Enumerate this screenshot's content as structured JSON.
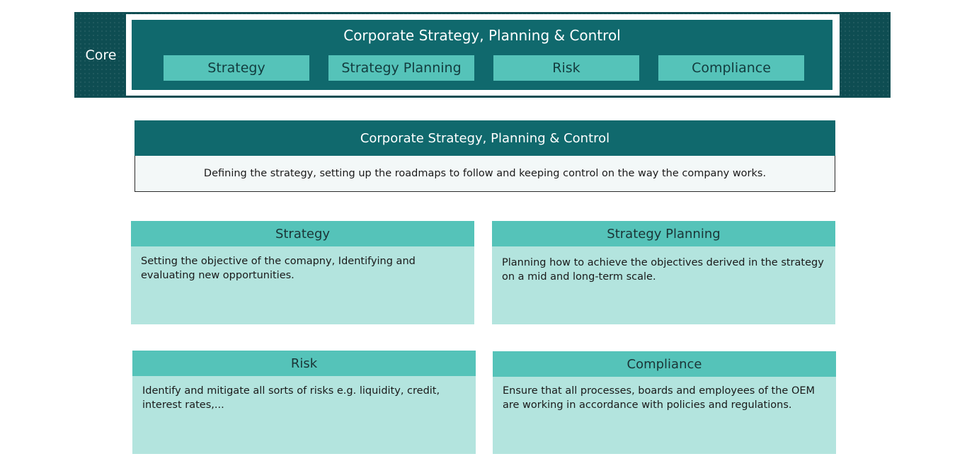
{
  "core": {
    "label": "Core",
    "title": "Corporate Strategy, Planning & Control",
    "tabs": [
      {
        "label": "Strategy"
      },
      {
        "label": "Strategy Planning"
      },
      {
        "label": "Risk"
      },
      {
        "label": "Compliance"
      }
    ]
  },
  "overview": {
    "title": "Corporate Strategy, Planning & Control",
    "description": "Defining the strategy, setting up the roadmaps to follow and keeping control on the way the company works."
  },
  "cards": [
    {
      "title": "Strategy",
      "description": "Setting the objective of the comapny, Identifying and evaluating new opportunities."
    },
    {
      "title": "Strategy Planning",
      "description": "Planning how to achieve the objectives derived in the strategy on a mid and long-term scale."
    },
    {
      "title": "Risk",
      "description": "Identify and mitigate all sorts of risks e.g. liquidity, credit, interest rates,..."
    },
    {
      "title": "Compliance",
      "description": "Ensure that all processes, boards and employees of the OEM are working in accordance with policies and regulations."
    }
  ],
  "colors": {
    "dark_teal": "#10696d",
    "core_band": "#0e4d52",
    "mid_teal": "#55c3b9",
    "light_teal": "#b3e4de"
  }
}
